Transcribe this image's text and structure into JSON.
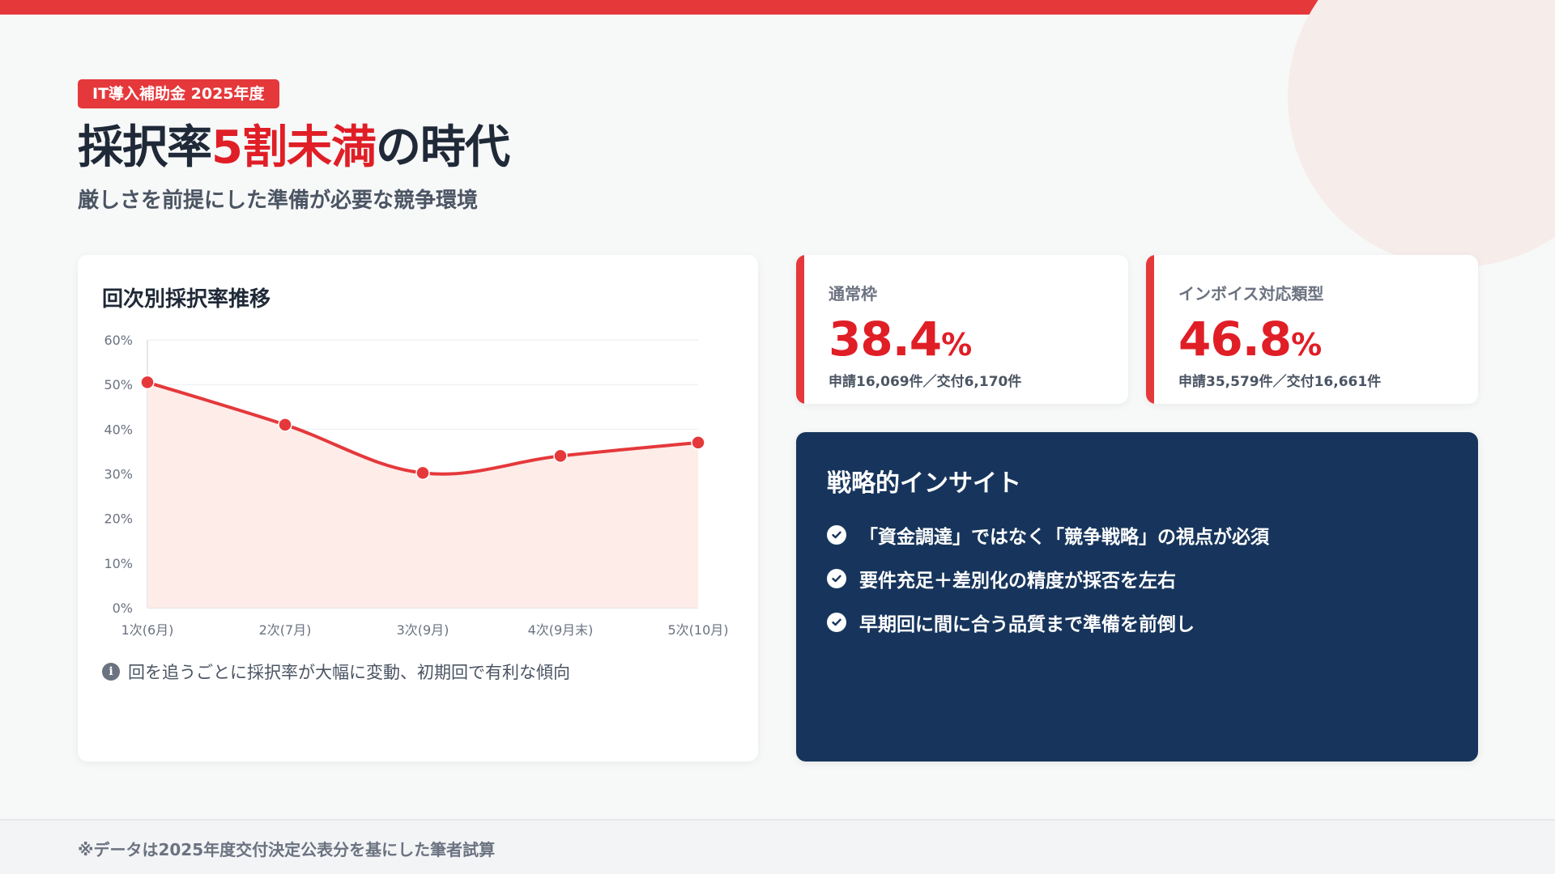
{
  "tag": "IT導入補助金 2025年度",
  "headline": {
    "pre": "採択率",
    "accent": "5割未満",
    "post": "の時代"
  },
  "subtitle": "厳しさを前提にした準備が必要な競争環境",
  "chart_card": {
    "title": "回次別採択率推移",
    "note": "回を追うごとに採択率が大幅に変動、初期回で有利な傾向"
  },
  "chart_data": {
    "type": "line",
    "title": "回次別採択率推移",
    "categories": [
      "1次(6月)",
      "2次(7月)",
      "3次(9月)",
      "4次(9月末)",
      "5次(10月)"
    ],
    "values": [
      50.5,
      41,
      30.2,
      34,
      37
    ],
    "ylim": [
      0,
      60
    ],
    "yticks": [
      "0%",
      "10%",
      "20%",
      "30%",
      "40%",
      "50%",
      "60%"
    ],
    "grid": true,
    "colors": {
      "line": "#e5383b",
      "fill": "#fdece8"
    }
  },
  "stats": [
    {
      "label": "通常枠",
      "value": "38.4",
      "unit": "%",
      "detail": "申請16,069件／交付6,170件"
    },
    {
      "label": "インボイス対応類型",
      "value": "46.8",
      "unit": "%",
      "detail": "申請35,579件／交付16,661件"
    }
  ],
  "insight": {
    "title": "戦略的インサイト",
    "items": [
      "「資金調達」ではなく「競争戦略」の視点が必須",
      "要件充足＋差別化の精度が採否を左右",
      "早期回に間に合う品質まで準備を前倒し"
    ]
  },
  "footer": "※データは2025年度交付決定公表分を基にした筆者試算",
  "colors": {
    "accent": "#e5383b",
    "navy": "#17355c"
  }
}
